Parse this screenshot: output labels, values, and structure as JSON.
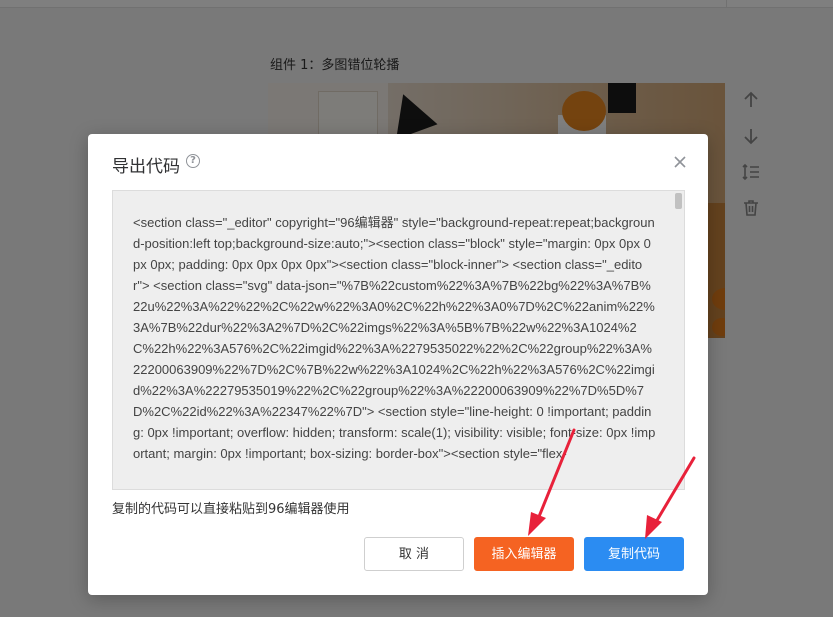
{
  "background": {
    "component_label": "组件 1：多图错位轮播",
    "tools": [
      {
        "icon": "arrow-up-icon"
      },
      {
        "icon": "arrow-down-icon"
      },
      {
        "icon": "line-height-icon"
      },
      {
        "icon": "trash-icon"
      }
    ]
  },
  "dialog": {
    "title": "导出代码",
    "help_icon": "question-circle-icon",
    "close_icon": "close-icon",
    "code": "<section class=\"_editor\" copyright=\"96编辑器\" style=\"background-repeat:repeat;background-position:left top;background-size:auto;\"><section class=\"block\" style=\"margin: 0px 0px 0px 0px; padding: 0px 0px 0px 0px\"><section class=\"block-inner\"> <section class=\"_editor\"> <section class=\"svg\" data-json=\"%7B%22custom%22%3A%7B%22bg%22%3A%7B%22u%22%3A%22%22%2C%22w%22%3A0%2C%22h%22%3A0%7D%2C%22anim%22%3A%7B%22dur%22%3A2%7D%2C%22imgs%22%3A%5B%7B%22w%22%3A1024%2C%22h%22%3A576%2C%22imgid%22%3A%2279535022%22%2C%22group%22%3A%22200063909%22%7D%2C%7B%22w%22%3A1024%2C%22h%22%3A576%2C%22imgid%22%3A%22279535019%22%2C%22group%22%3A%22200063909%22%7D%5D%7D%2C%22id%22%3A%22347%22%7D\"> <section style=\"line-height: 0 !important; padding: 0px !important; overflow: hidden; transform: scale(1); visibility: visible; font-size: 0px !important; margin: 0px !important; box-sizing: border-box\"><section style=\"flex-",
    "hint": "复制的代码可以直接粘贴到96编辑器使用",
    "buttons": {
      "cancel": "取 消",
      "insert": "插入编辑器",
      "copy": "复制代码"
    }
  },
  "colors": {
    "insert_button": "#f56322",
    "copy_button": "#2b8cf2",
    "annotation_arrow": "#e8213a"
  }
}
